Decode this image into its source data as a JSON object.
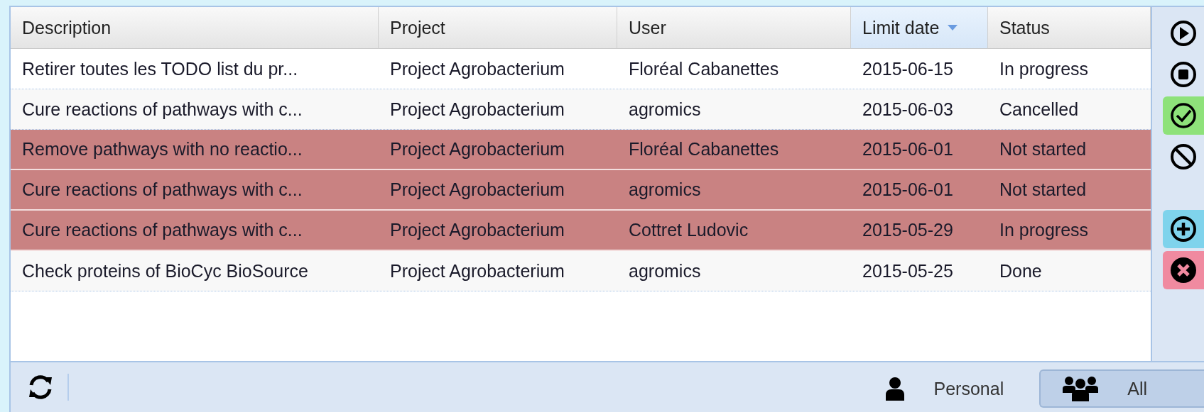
{
  "table": {
    "columns": [
      {
        "label": "Description",
        "sorted": false
      },
      {
        "label": "Project",
        "sorted": false
      },
      {
        "label": "User",
        "sorted": false
      },
      {
        "label": "Limit date",
        "sorted": true
      },
      {
        "label": "Status",
        "sorted": false
      }
    ],
    "rows": [
      {
        "overdue": false,
        "cells": [
          "Retirer toutes les TODO list du pr...",
          "Project Agrobacterium",
          "Floréal Cabanettes",
          "2015-06-15",
          "In progress"
        ]
      },
      {
        "overdue": false,
        "cells": [
          "Cure reactions of pathways with c...",
          "Project Agrobacterium",
          "agromics",
          "2015-06-03",
          "Cancelled"
        ]
      },
      {
        "overdue": true,
        "cells": [
          "Remove pathways with no reactio...",
          "Project Agrobacterium",
          "Floréal Cabanettes",
          "2015-06-01",
          "Not started"
        ]
      },
      {
        "overdue": true,
        "cells": [
          "Cure reactions of pathways with c...",
          "Project Agrobacterium",
          "agromics",
          "2015-06-01",
          "Not started"
        ]
      },
      {
        "overdue": true,
        "cells": [
          "Cure reactions of pathways with c...",
          "Project Agrobacterium",
          "Cottret Ludovic",
          "2015-05-29",
          "In progress"
        ]
      },
      {
        "overdue": false,
        "cells": [
          "Check proteins of BioCyc BioSource",
          "Project Agrobacterium",
          "agromics",
          "2015-05-25",
          "Done"
        ]
      }
    ]
  },
  "side_toolbar": [
    {
      "kind": "play"
    },
    {
      "kind": "stop"
    },
    {
      "kind": "check",
      "color": "#8ee27a"
    },
    {
      "kind": "ban"
    },
    {
      "kind": "gap"
    },
    {
      "kind": "add",
      "color": "#7fd3ec"
    },
    {
      "kind": "remove",
      "color": "#f08aa0"
    }
  ],
  "bottom_bar": {
    "filters": [
      {
        "kind": "personal",
        "label": "Personal",
        "selected": false
      },
      {
        "kind": "all",
        "label": "All",
        "selected": true
      }
    ]
  }
}
